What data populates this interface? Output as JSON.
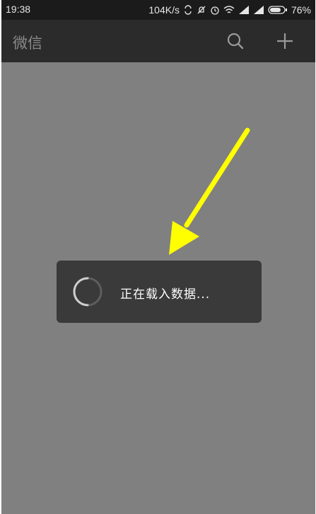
{
  "status_bar": {
    "time": "19:38",
    "net_speed": "104K/s",
    "battery": "76%",
    "icons": [
      "sync-icon",
      "mute-icon",
      "alarm-icon",
      "wifi-icon",
      "signal-icon",
      "signal-icon",
      "battery-icon"
    ]
  },
  "header": {
    "title": "微信",
    "search_icon": "search-icon",
    "add_icon": "plus-icon"
  },
  "loading": {
    "text": "正在载入数据..."
  },
  "colors": {
    "status_bar_bg": "#1b1b1b",
    "title_bar_bg": "#2b2b2b",
    "content_bg": "#808080",
    "toast_bg": "#3a3a3a",
    "arrow": "#ffff00"
  }
}
